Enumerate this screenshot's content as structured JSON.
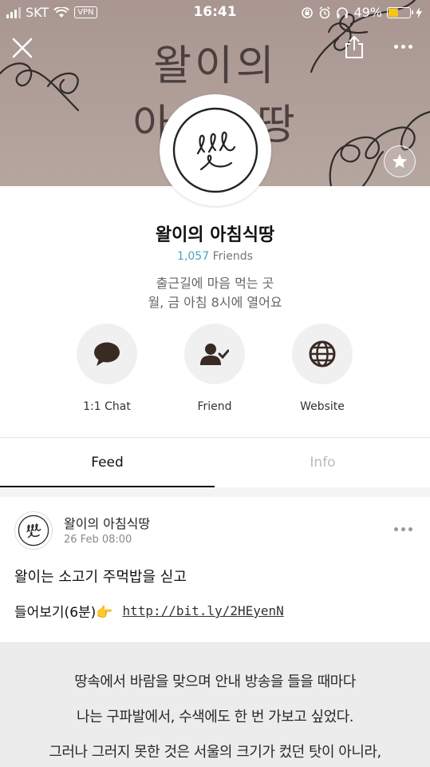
{
  "status_bar": {
    "carrier": "SKT",
    "vpn_label": "VPN",
    "time": "16:41",
    "battery_percent": "49%",
    "battery_level": 0.49
  },
  "banner": {
    "title_line1": "왈이의",
    "title_line2": "아침식땅"
  },
  "profile": {
    "name": "왈이의 아침식땅",
    "friends_count": "1,057",
    "friends_label": "Friends",
    "desc_line1": "출근길에 마음 먹는 곳",
    "desc_line2": "월, 금 아침 8시에 열어요"
  },
  "actions": [
    {
      "label": "1:1 Chat",
      "icon": "chat-bubble-icon"
    },
    {
      "label": "Friend",
      "icon": "friend-added-icon"
    },
    {
      "label": "Website",
      "icon": "globe-icon"
    }
  ],
  "tabs": {
    "feed": "Feed",
    "info": "Info"
  },
  "post": {
    "author": "왈이의 아침식땅",
    "date": "26 Feb 08:00",
    "line1": "왈이는 소고기 주먹밥을 싣고",
    "line2_text": "들어보기(6분)👉",
    "link": "http://bit.ly/2HEyenN",
    "image_text": [
      "땅속에서 바람을 맞으며 안내 방송을 들을 때마다",
      "나는 구파발에서, 수색에도 한 번 가보고 싶었다.",
      "그러나 그러지 못한 것은 서울의 크기가 컸던 탓이 아니라,"
    ]
  },
  "colors": {
    "banner_bg": "#b19f99",
    "friends_count": "#4aa3c4",
    "battery_fill": "#f5c518"
  }
}
